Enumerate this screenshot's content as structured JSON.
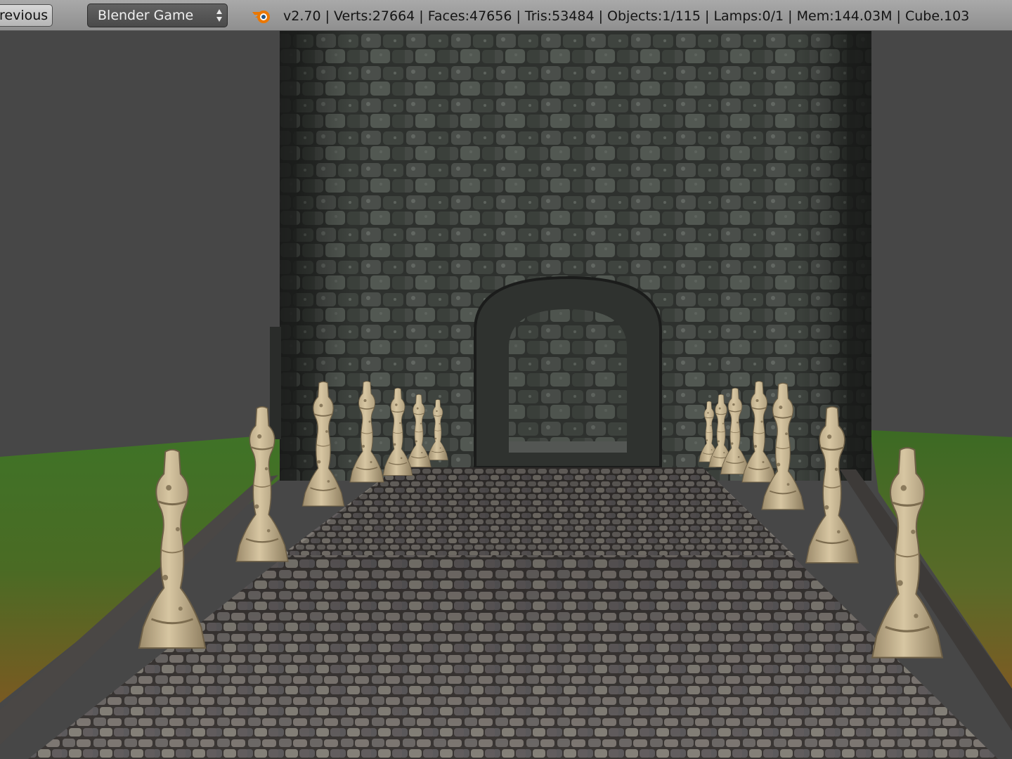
{
  "header": {
    "previous_label": "revious",
    "engine": {
      "selected": "Blender Game"
    },
    "logo_icon": "blender-logo-icon",
    "stats": "v2.70 | Verts:27664 | Faces:47656 | Tris:53484 | Objects:1/115 | Lamps:0/1 | Mem:144.03M | Cube.103"
  },
  "viewport": {
    "colors": {
      "background": "#474747",
      "tower_stone": "#3b3f3b",
      "cobblestone": "#5e5a58",
      "pillar": "#c9b592",
      "grass": "#3e6a22"
    }
  }
}
